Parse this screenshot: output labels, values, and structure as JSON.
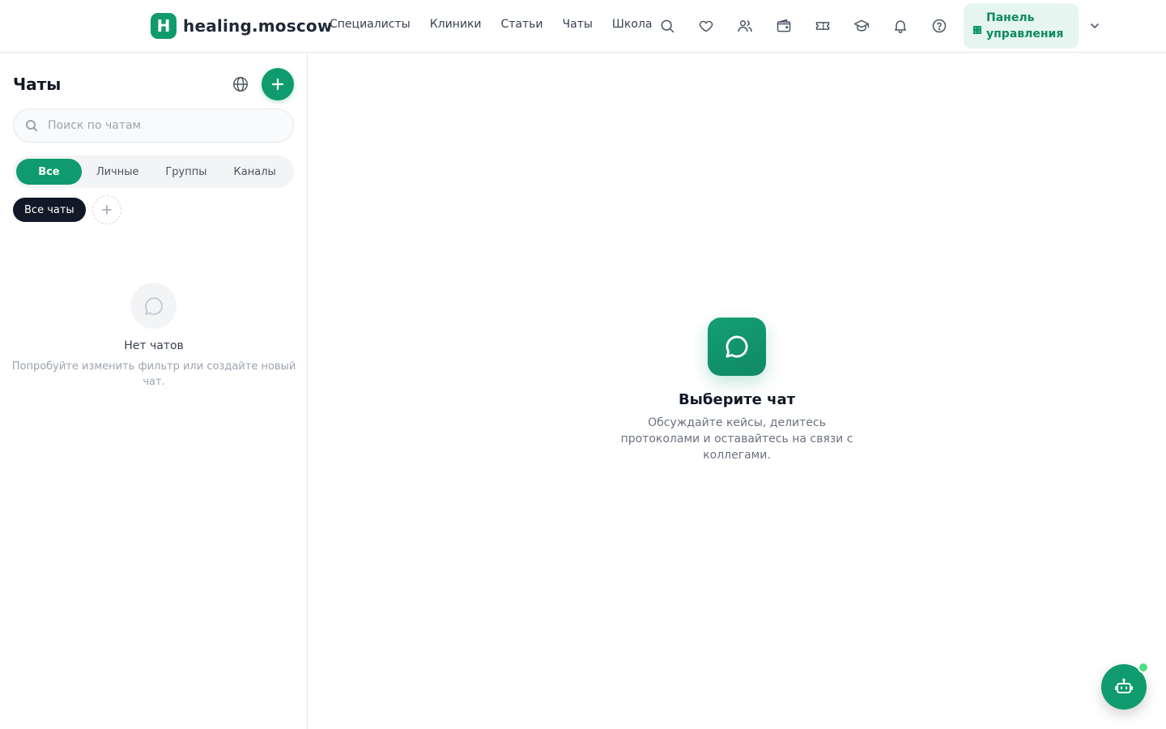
{
  "header": {
    "logo_letter": "H",
    "logo_text": "healing.moscow",
    "nav": [
      "Специалисты",
      "Клиники",
      "Статьи",
      "Чаты",
      "Школа"
    ],
    "icons": [
      "search-icon",
      "heart-icon",
      "users-icon",
      "wallet-icon",
      "ticket-icon",
      "graduation-cap-icon",
      "bell-icon",
      "help-icon"
    ],
    "panel_label": "Панель управления"
  },
  "sidebar": {
    "title": "Чаты",
    "search_placeholder": "Поиск по чатам",
    "tabs": [
      "Все",
      "Личные",
      "Группы",
      "Каналы"
    ],
    "active_tab": "Все",
    "folder_chip": "Все чаты",
    "empty_title": "Нет чатов",
    "empty_subtitle": "Попробуйте изменить фильтр или создайте новый чат."
  },
  "main": {
    "title": "Выберите чат",
    "subtitle": "Обсуждайте кейсы, делитесь протоколами и оставайтесь на связи с коллегами."
  },
  "colors": {
    "accent": "#0f9b6e",
    "dark_chip": "#111827",
    "online_dot": "#4ade80"
  }
}
